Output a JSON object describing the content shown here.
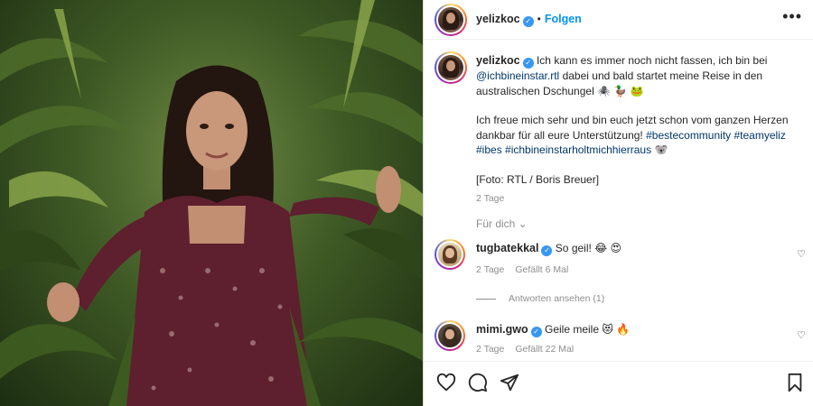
{
  "post": {
    "author": "yelizkoc",
    "follow_label": "Folgen",
    "more_label": "•••",
    "caption_author": "yelizkoc",
    "caption_line1_a": " Ich kann es immer noch nicht fassen, ich bin bei ",
    "caption_mention": "@ichbineinstar.rtl",
    "caption_line1_b": " dabei und bald startet meine Reise in den australischen Dschungel 🕷️ 🦆 🐸",
    "caption_p2_a": "Ich freue mich sehr und bin euch jetzt schon vom ganzen Herzen dankbar für all eure Unterstützung! ",
    "caption_tags": "#bestecommunity #teamyeliz #ibes #ichbineinstarholtmichhierraus",
    "caption_p2_b": " 🐨",
    "caption_p3": "[Foto: RTL / Boris Breuer]",
    "caption_time": "2 Tage",
    "see_all_label": "Für dich ⌄"
  },
  "comments": [
    {
      "username": "tugbatekkal",
      "text": " So geil! 😂 😍",
      "time": "2 Tage",
      "likes": "Gefällt 6 Mal",
      "replies_label": "Antworten ansehen (1)"
    },
    {
      "username": "mimi.gwo",
      "text": " Geile meile 😻 🔥",
      "time": "2 Tage",
      "likes": "Gefällt 22 Mal"
    }
  ],
  "icons": {
    "like": "heart-icon",
    "comment": "comment-icon",
    "share": "share-icon",
    "save": "bookmark-icon",
    "verified": "verified-badge-icon",
    "more": "more-options-icon"
  },
  "colors": {
    "link": "#00376b",
    "follow": "#0095f6",
    "verified": "#3897f0",
    "muted": "#8e8e8e"
  }
}
